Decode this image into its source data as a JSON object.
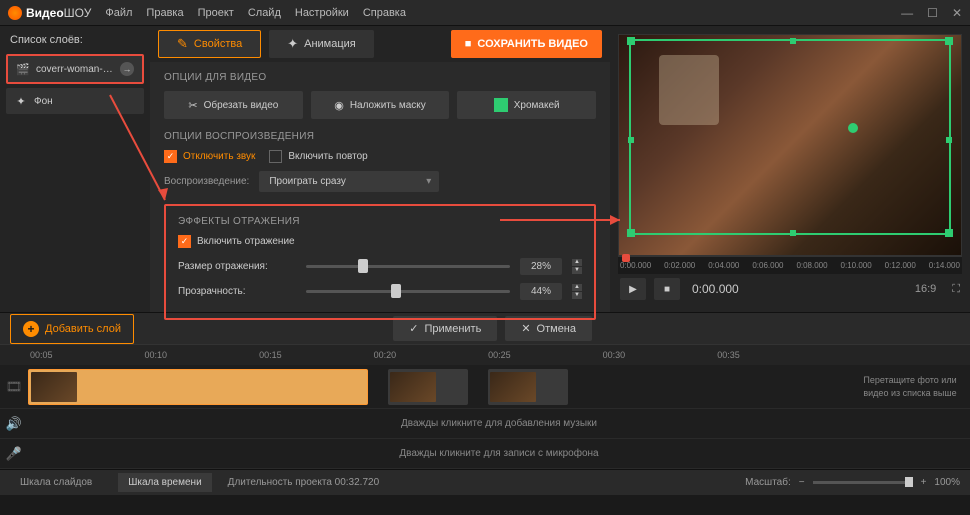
{
  "app": {
    "name_a": "Видео",
    "name_b": "ШОУ"
  },
  "menu": [
    "Файл",
    "Правка",
    "Проект",
    "Слайд",
    "Настройки",
    "Справка"
  ],
  "layers": {
    "title": "Список слоёв:",
    "items": [
      {
        "name": "coverr-woman-d...",
        "icon": "film"
      },
      {
        "name": "Фон",
        "icon": "wand"
      }
    ]
  },
  "tabs": {
    "props": "Свойства",
    "anim": "Анимация"
  },
  "save": "СОХРАНИТЬ ВИДЕО",
  "video_opts": {
    "title": "ОПЦИИ ДЛЯ ВИДЕО",
    "crop": "Обрезать видео",
    "mask": "Наложить маску",
    "chroma": "Хромакей"
  },
  "play_opts": {
    "title": "ОПЦИИ ВОСПРОИЗВЕДЕНИЯ",
    "mute": "Отключить звук",
    "loop": "Включить повтор",
    "playback_label": "Воспроизведение:",
    "playback_value": "Проиграть сразу"
  },
  "reflection": {
    "title": "ЭФФЕКТЫ ОТРАЖЕНИЯ",
    "enable": "Включить отражение",
    "size_label": "Размер отражения:",
    "size_value": "28%",
    "opacity_label": "Прозрачность:",
    "opacity_value": "44%"
  },
  "actions": {
    "add_layer": "Добавить слой",
    "apply": "Применить",
    "cancel": "Отмена"
  },
  "preview": {
    "ruler": [
      "0:00.000",
      "0:02.000",
      "0:04.000",
      "0:06.000",
      "0:08.000",
      "0:10.000",
      "0:12.000",
      "0:14.000"
    ],
    "timecode": "0:00.000",
    "aspect": "16:9"
  },
  "timeline": {
    "ruler": [
      "00:05",
      "00:10",
      "00:15",
      "00:20",
      "00:25",
      "00:30",
      "00:35"
    ],
    "drag_hint": "Перетащите фото или видео из списка выше",
    "music_hint": "Дважды кликните для добавления музыки",
    "mic_hint": "Дважды кликните для записи с микрофона"
  },
  "bottom": {
    "tabs": [
      "Шкала слайдов",
      "Шкала времени"
    ],
    "duration": "Длительность проекта 00:32.720",
    "zoom_label": "Масштаб:",
    "zoom_value": "100%"
  }
}
